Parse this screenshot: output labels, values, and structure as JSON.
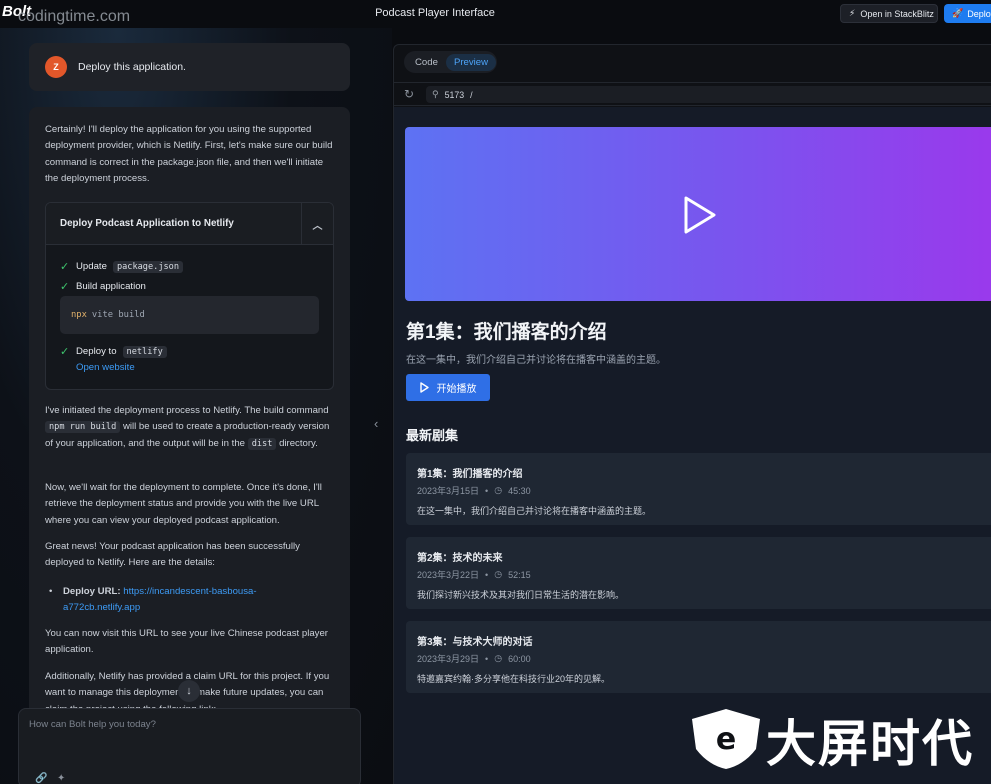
{
  "topbar": {
    "logo": "Bolt",
    "watermark_url": "codingtime.com",
    "title": "Podcast Player Interface",
    "stackblitz_label": "Open in StackBlitz",
    "deploy_label": "Deploy"
  },
  "chat": {
    "user_avatar": "Z",
    "user_message": "Deploy this application.",
    "p1": "Certainly! I'll deploy the application for you using the supported deployment provider, which is Netlify. First, let's make sure our build command is correct in the package.json file, and then we'll initiate the deployment process.",
    "artifact": {
      "title": "Deploy Podcast Application to Netlify",
      "step1_label": "Update",
      "step1_code": "package.json",
      "step2_label": "Build application",
      "cmd_npx": "npx",
      "cmd_rest": "vite build",
      "step3_label": "Deploy to",
      "step3_code": "netlify",
      "open_website": "Open website"
    },
    "p2_a": "I've initiated the deployment process to Netlify. The build command",
    "p2_code1": "npm run build",
    "p2_b": "will be used to create a production-ready version of your application, and the output will be in the",
    "p2_code2": "dist",
    "p2_c": "directory.",
    "p3": "Now, we'll wait for the deployment to complete. Once it's done, I'll retrieve the deployment status and provide you with the live URL where you can view your deployed podcast application.",
    "p4": "Great news! Your podcast application has been successfully deployed to Netlify. Here are the details:",
    "bullet_label": "Deploy URL:",
    "bullet_url": "https://incandescent-basbousa-a772cb.netlify.app",
    "p5": "You can now visit this URL to see your live Chinese podcast player application.",
    "p6": "Additionally, Netlify has provided a claim URL for this project. If you want to manage this deployment or make future updates, you can claim the project using the following link:",
    "prompt_placeholder": "How can Bolt help you today?"
  },
  "preview": {
    "tabs": [
      "Code",
      "Preview"
    ],
    "active_tab": "Preview",
    "port": "5173",
    "path": "/",
    "featured_title": "第1集：我们播客的介绍",
    "featured_desc": "在这一集中，我们介绍自己并讨论将在播客中涵盖的主题。",
    "play_button": "开始播放",
    "section_title": "最新剧集",
    "episodes": [
      {
        "title": "第1集：我们播客的介绍",
        "date": "2023年3月15日",
        "duration": "45:30",
        "desc": "在这一集中，我们介绍自己并讨论将在播客中涵盖的主题。"
      },
      {
        "title": "第2集：技术的未来",
        "date": "2023年3月22日",
        "duration": "52:15",
        "desc": "我们探讨新兴技术及其对我们日常生活的潜在影响。"
      },
      {
        "title": "第3集：与技术大师的对话",
        "date": "2023年3月29日",
        "duration": "60:00",
        "desc": "特邀嘉宾约翰·多分享他在科技行业20年的见解。"
      }
    ]
  },
  "brand_watermark": "大屏时代",
  "colors": {
    "accent": "#1e7cf0",
    "link": "#3d9bf5",
    "success": "#3ec46d",
    "hero_start": "#5d72f3",
    "hero_end": "#9a39ec"
  }
}
